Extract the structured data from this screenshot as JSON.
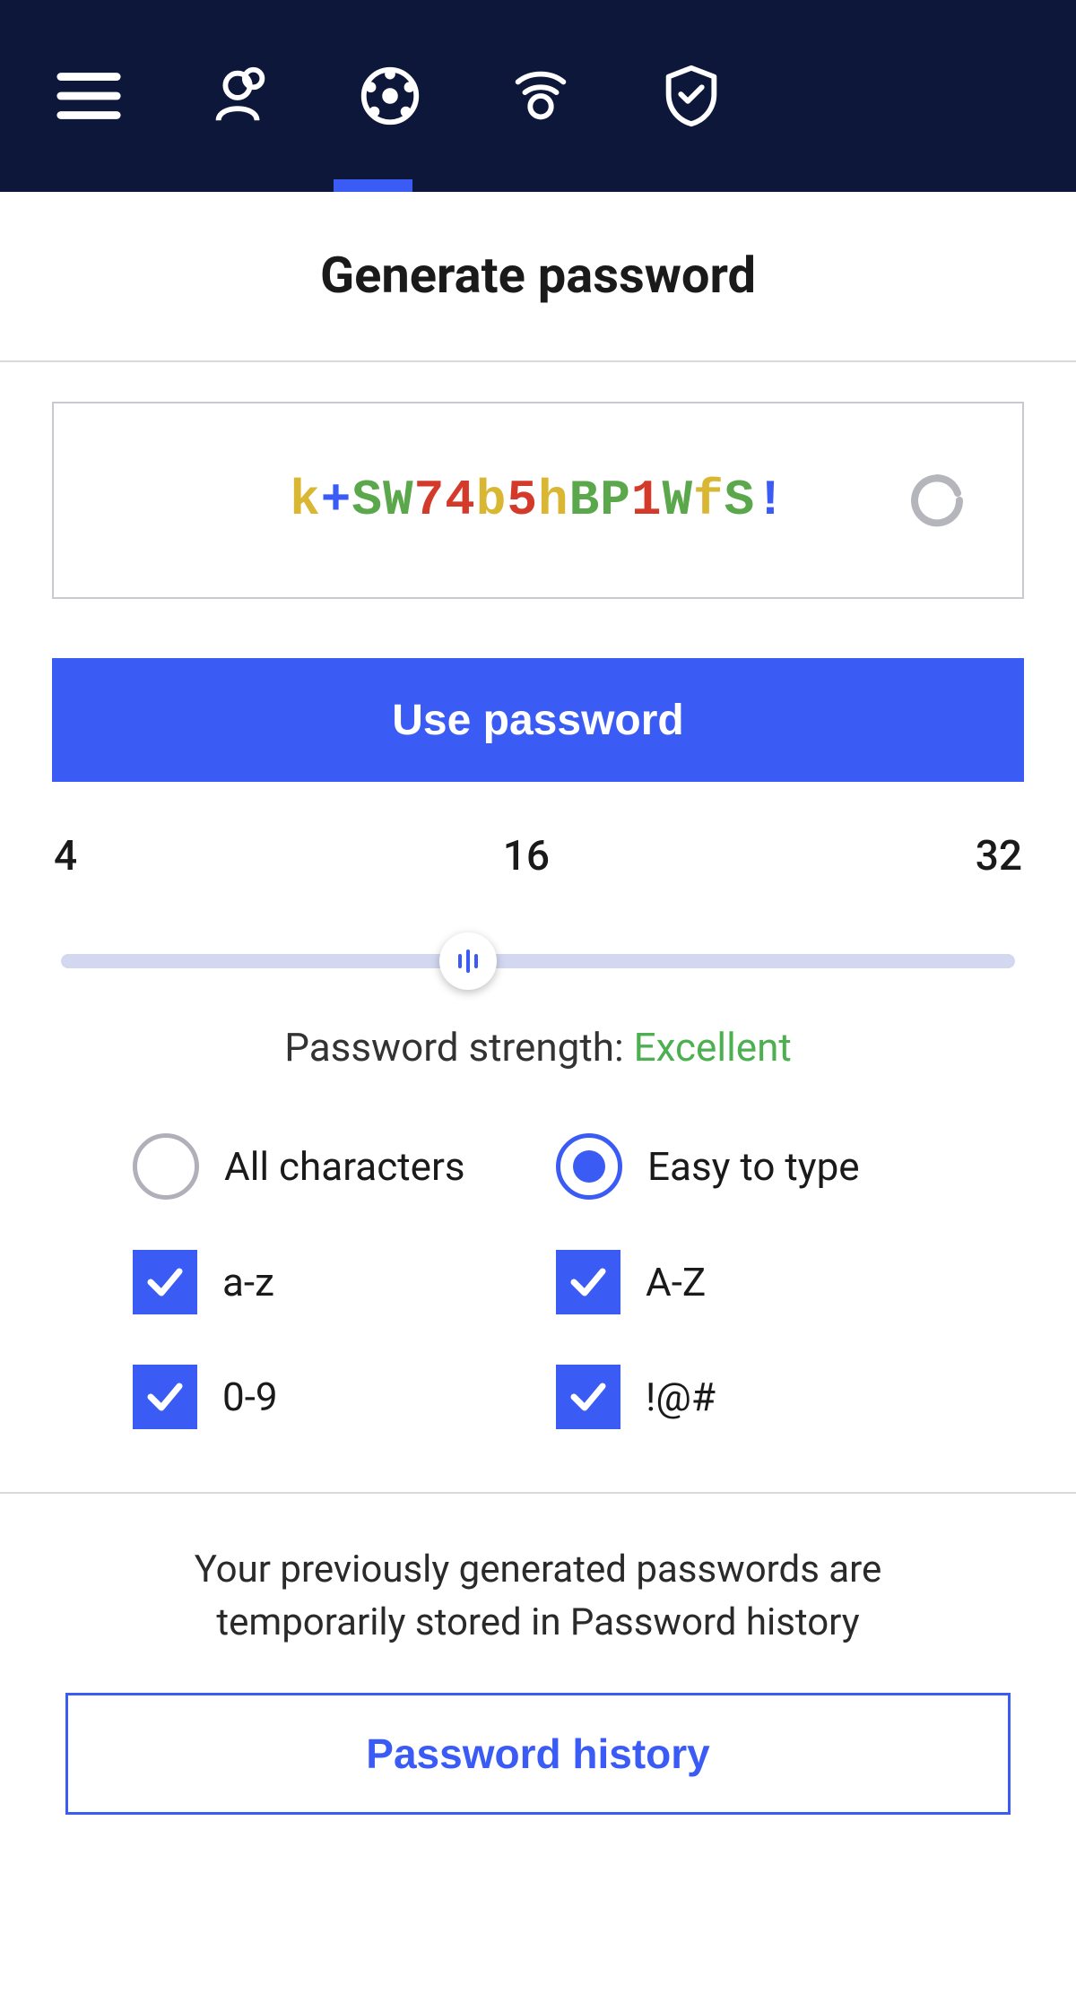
{
  "page": {
    "title": "Generate password"
  },
  "password": {
    "chars": [
      {
        "c": "k",
        "color": "#d9b732"
      },
      {
        "c": "+",
        "color": "#3b5bf5"
      },
      {
        "c": "S",
        "color": "#5aa84b"
      },
      {
        "c": "W",
        "color": "#5aa84b"
      },
      {
        "c": "7",
        "color": "#d43a2a"
      },
      {
        "c": "4",
        "color": "#d43a2a"
      },
      {
        "c": "b",
        "color": "#d9b732"
      },
      {
        "c": "5",
        "color": "#d43a2a"
      },
      {
        "c": "h",
        "color": "#d9b732"
      },
      {
        "c": "B",
        "color": "#5aa84b"
      },
      {
        "c": "P",
        "color": "#5aa84b"
      },
      {
        "c": "1",
        "color": "#d43a2a"
      },
      {
        "c": "W",
        "color": "#5aa84b"
      },
      {
        "c": "f",
        "color": "#d9b732"
      },
      {
        "c": "S",
        "color": "#5aa84b"
      },
      {
        "c": "!",
        "color": "#3b5bf5"
      }
    ]
  },
  "buttons": {
    "use_password": "Use password",
    "password_history": "Password history"
  },
  "slider": {
    "min": "4",
    "current": "16",
    "max": "32"
  },
  "strength": {
    "label": "Password strength: ",
    "value": "Excellent"
  },
  "options": {
    "radio_all": "All characters",
    "radio_easy": "Easy to type",
    "radio_selected": "easy",
    "cb_lower": "a-z",
    "cb_upper": "A-Z",
    "cb_digits": "0-9",
    "cb_symbols": "!@#",
    "cb_lower_checked": true,
    "cb_upper_checked": true,
    "cb_digits_checked": true,
    "cb_symbols_checked": true
  },
  "history": {
    "text": "Your previously generated passwords are temporarily stored in Password history"
  }
}
